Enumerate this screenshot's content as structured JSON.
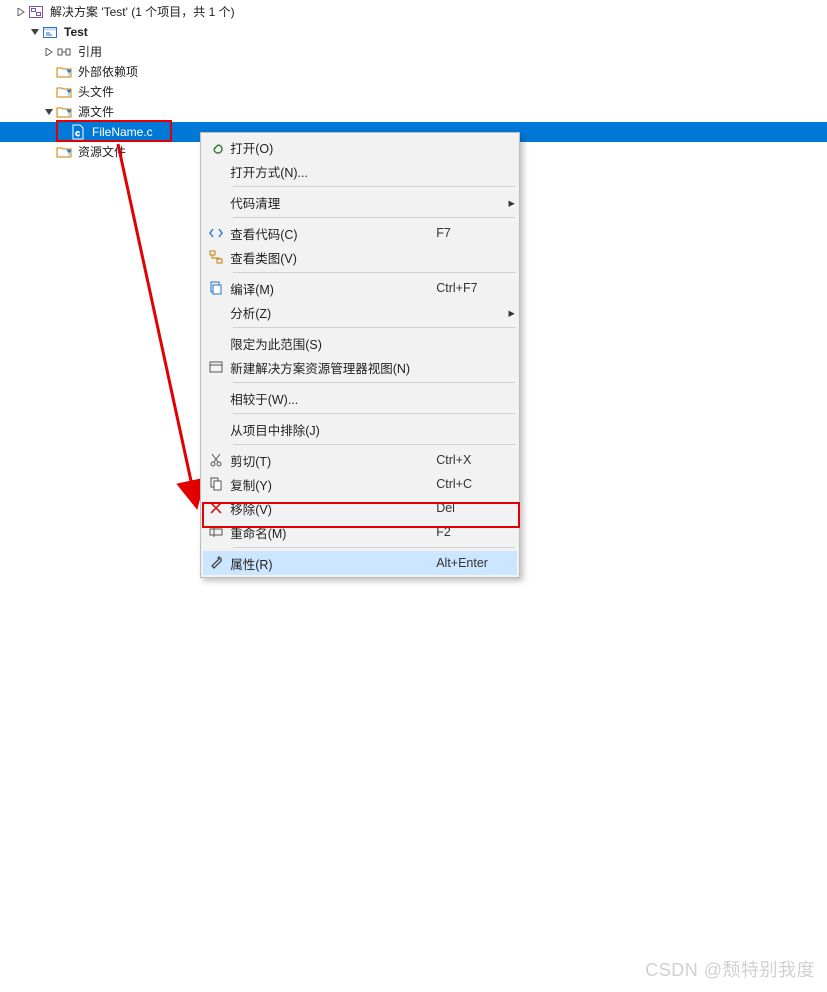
{
  "tree": {
    "solution_label": "解决方案 'Test' (1 个项目，共 1 个)",
    "project_label": "Test",
    "refs_label": "引用",
    "external_label": "外部依赖项",
    "header_files_label": "头文件",
    "source_files_label": "源文件",
    "filename_label": "FileName.c",
    "resource_files_label": "资源文件"
  },
  "menu": {
    "open": "打开(O)",
    "open_with": "打开方式(N)...",
    "code_cleanup": "代码清理",
    "view_code": "查看代码(C)",
    "view_code_sc": "F7",
    "view_class": "查看类图(V)",
    "compile": "编译(M)",
    "compile_sc": "Ctrl+F7",
    "analyze": "分析(Z)",
    "scope": "限定为此范围(S)",
    "new_explorer": "新建解决方案资源管理器视图(N)",
    "compare": "相较于(W)...",
    "exclude": "从项目中排除(J)",
    "cut": "剪切(T)",
    "cut_sc": "Ctrl+X",
    "copy": "复制(Y)",
    "copy_sc": "Ctrl+C",
    "remove": "移除(V)",
    "remove_sc": "Del",
    "rename": "重命名(M)",
    "rename_sc": "F2",
    "properties": "属性(R)",
    "properties_sc": "Alt+Enter"
  },
  "watermark": "CSDN @颓特别我度",
  "colors": {
    "selection": "#0078d7",
    "highlight": "#cce6ff",
    "annotation": "#e20000"
  }
}
